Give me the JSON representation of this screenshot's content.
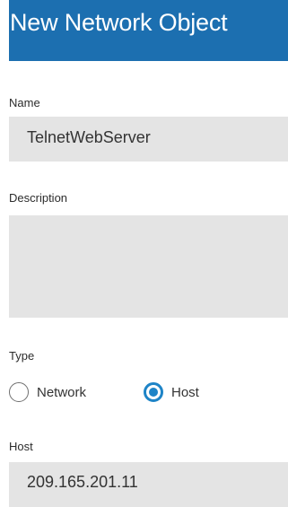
{
  "dialog": {
    "title": "New Network Object"
  },
  "name": {
    "label": "Name",
    "value": "TelnetWebServer"
  },
  "description": {
    "label": "Description",
    "value": ""
  },
  "type": {
    "label": "Type",
    "options": [
      {
        "label": "Network",
        "selected": false
      },
      {
        "label": "Host",
        "selected": true
      }
    ]
  },
  "host": {
    "label": "Host",
    "value": "209.165.201.11"
  },
  "colors": {
    "header_bg": "#1c6fb0",
    "field_bg": "#e4e4e4",
    "radio_accent": "#1e84c7"
  }
}
